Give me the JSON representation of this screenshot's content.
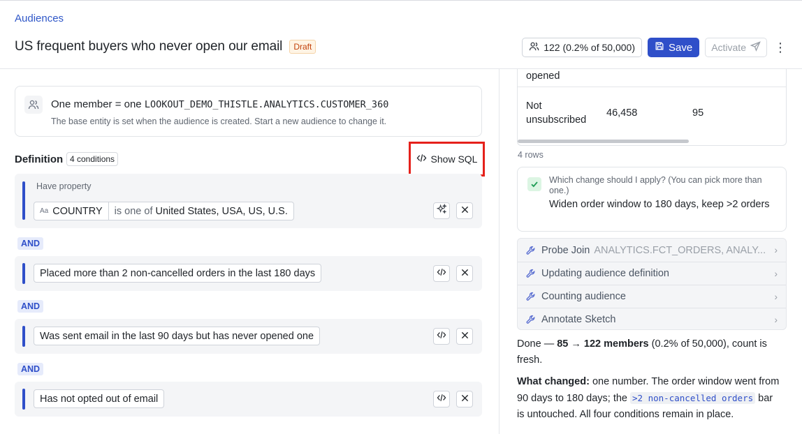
{
  "breadcrumb": "Audiences",
  "header": {
    "title": "US frequent buyers who never open our email",
    "status_badge": "Draft",
    "member_count": "122 (0.2% of 50,000)",
    "save_label": "Save",
    "activate_label": "Activate"
  },
  "base_entity": {
    "prefix": "One member = one",
    "entity": "LOOKOUT_DEMO_THISTLE.ANALYTICS.CUSTOMER_360",
    "note": "The base entity is set when the audience is created. Start a new audience to change it."
  },
  "definition": {
    "label": "Definition",
    "condition_count": "4 conditions",
    "show_sql_label": "Show SQL",
    "and_label": "AND",
    "conditions": [
      {
        "sublabel": "Have property",
        "field_type": "Aa",
        "field": "COUNTRY",
        "operator": "is one of",
        "value": "United States, USA, US, U.S."
      },
      {
        "text": "Placed more than 2 non-cancelled orders in the last 180 days"
      },
      {
        "text": "Was sent email in the last 90 days but has never opened one"
      },
      {
        "text": "Has not opted out of email"
      }
    ]
  },
  "results_table": {
    "partial_row_label": "opened",
    "rows": [
      {
        "label_line1": "Not",
        "label_line2": "unsubscribed",
        "value1": "46,458",
        "value2": "95"
      }
    ],
    "rows_count": "4 rows"
  },
  "question": {
    "prompt": "Which change should I apply? (You can pick more than one.)",
    "answer": "Widen order window to 180 days, keep >2 orders"
  },
  "tools": [
    {
      "label": "Probe Join",
      "detail": "ANALYTICS.FCT_ORDERS, ANALY..."
    },
    {
      "label": "Updating audience definition",
      "detail": ""
    },
    {
      "label": "Counting audience",
      "detail": ""
    },
    {
      "label": "Annotate Sketch",
      "detail": ""
    }
  ],
  "summary": {
    "done_prefix": "Done —",
    "done_bold": "85 → 122 members",
    "done_suffix": "(0.2% of 50,000), count is fresh.",
    "changed_label": "What changed:",
    "changed_text_1": "one number. The order window went from 90 days to 180 days; the",
    "changed_code": ">2 non-cancelled orders",
    "changed_text_2": "bar is untouched. All four conditions remain in place."
  },
  "colors": {
    "accent": "#2f4fc9",
    "highlight_box": "#e5211b",
    "draft": "#c2410c"
  }
}
